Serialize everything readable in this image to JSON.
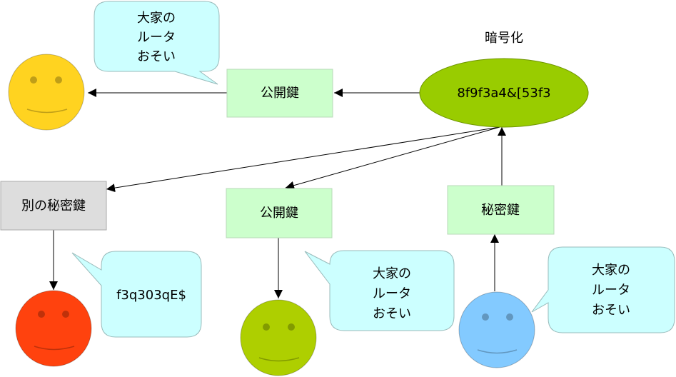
{
  "colors": {
    "key_box_fill": "#ccffcc",
    "key_box_stroke": "#b8d8b8",
    "other_key_fill": "#dddddd",
    "other_key_stroke": "#aaaaaa",
    "ellipse_fill": "#99cc00",
    "ellipse_stroke": "#6d9400",
    "bubble_fill": "#ccffff",
    "bubble_stroke": "#99bbbb",
    "face_yellow": "#ffd320",
    "face_red": "#ff420e",
    "face_green": "#aecf00",
    "face_blue": "#83caff",
    "arrow": "#000000"
  },
  "encryption": {
    "label": "暗号化",
    "ciphertext": "8f9f3a4&[53f3"
  },
  "keys": {
    "top_public": "公開鍵",
    "middle_public": "公開鍵",
    "private": "秘密鍵",
    "other_private": "別の秘密鍵"
  },
  "bubbles": {
    "top_left": {
      "lines": [
        "大家の",
        "ルータ",
        "おそい"
      ]
    },
    "bottom_left": {
      "text": "f3q303qE$"
    },
    "bottom_middle": {
      "lines": [
        "大家の",
        "ルータ",
        "おそい"
      ]
    },
    "bottom_right": {
      "lines": [
        "大家の",
        "ルータ",
        "おそい"
      ]
    }
  },
  "faces": [
    {
      "name": "yellow-face",
      "color_key": "face_yellow"
    },
    {
      "name": "red-face",
      "color_key": "face_red"
    },
    {
      "name": "green-face",
      "color_key": "face_green"
    },
    {
      "name": "blue-face",
      "color_key": "face_blue"
    }
  ]
}
